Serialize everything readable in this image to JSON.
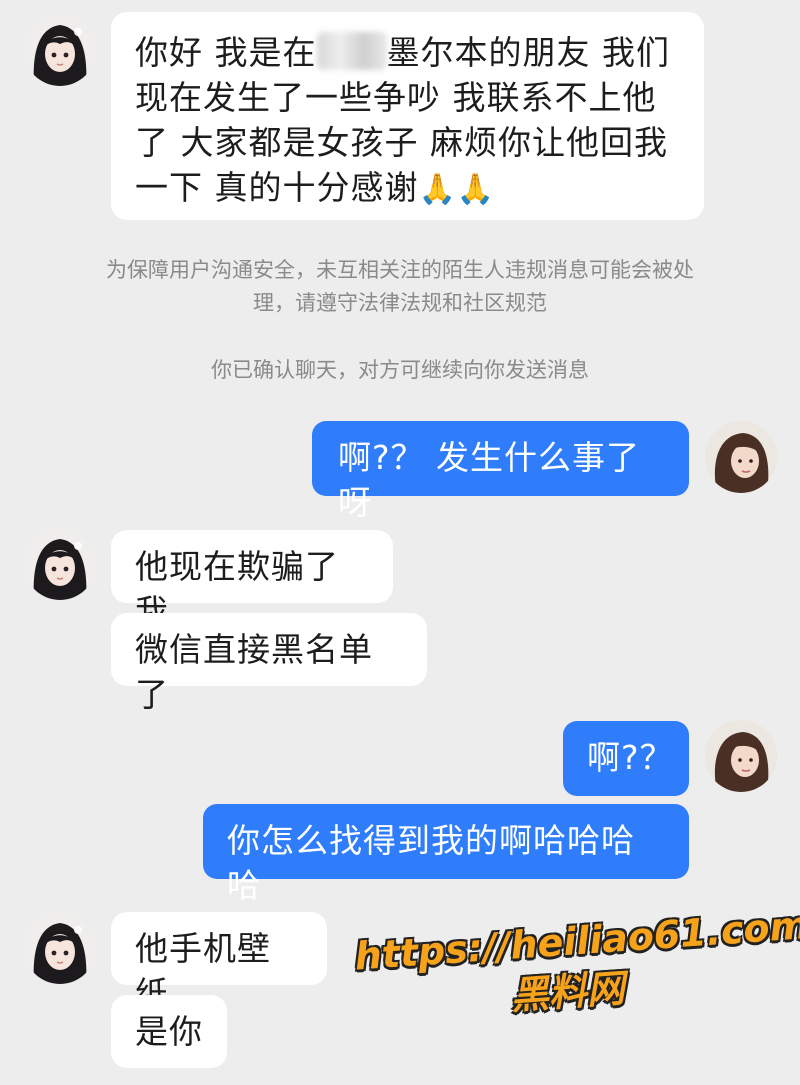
{
  "messages": {
    "m1": {
      "before": "你好 我是在",
      "after": "墨尔本的朋友 我们现在发生了一些争吵 我联系不上他了 大家都是女孩子 麻烦你让他回我一下 真的十分感谢",
      "emoji": "🙏🙏"
    },
    "sys1": "为保障用户沟通安全，未互相关注的陌生人违规消息可能会被处理，请遵守法律法规和社区规范",
    "sys2": "你已确认聊天，对方可继续向你发送消息",
    "m2": "啊?？ 发生什么事了呀",
    "m3": "他现在欺骗了我",
    "m4": "微信直接黑名单了",
    "m5": "啊?？",
    "m6": "你怎么找得到我的啊哈哈哈哈",
    "m7": "他手机壁纸",
    "m8": "是你"
  },
  "watermark": {
    "url": "https://heiliao61.com",
    "name": "黑料网"
  },
  "colors": {
    "background": "#ededed",
    "incoming": "#ffffff",
    "outgoing": "#2f7dfb",
    "watermark": "#f7a21b"
  }
}
